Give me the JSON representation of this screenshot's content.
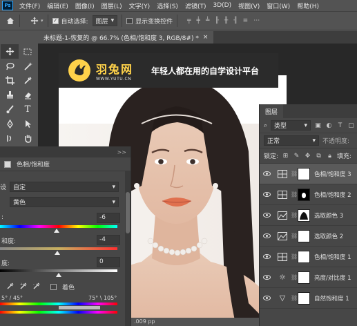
{
  "menubar": {
    "logo": "Ps",
    "items": [
      "文件(F)",
      "编辑(E)",
      "图像(I)",
      "图层(L)",
      "文字(Y)",
      "选择(S)",
      "滤镜(T)",
      "3D(D)",
      "视图(V)",
      "窗口(W)",
      "帮助(H)"
    ]
  },
  "options": {
    "auto_select_label": "自动选择:",
    "auto_select_target": "图层",
    "show_transform_label": "显示变换控件"
  },
  "document": {
    "tab_title": "未标题-1-恢复的 @ 66.7% (色相/饱和度 3, RGB/8#) *",
    "close": "×"
  },
  "watermark": {
    "brand": "羽兔网",
    "url": "WWW.YUTU.CN",
    "slogan": "年轻人都在用的自学设计平台"
  },
  "properties": {
    "panel_expand": ">>",
    "title": "色相/饱和度",
    "preset_label": "设",
    "preset_value": "自定",
    "channel_value": "黄色",
    "hue_label": ":",
    "hue_value": "-6",
    "hue_level": 0.48,
    "saturation_label": "和度:",
    "saturation_value": "-4",
    "saturation_level": 0.49,
    "lightness_label": "度:",
    "lightness_value": "0",
    "lightness_level": 0.5,
    "colorize_label": "着色",
    "range_left": "5° / 45°",
    "range_right": "75° \\ 105°"
  },
  "layers": {
    "tab_label": "图层",
    "filter_kind": "类型",
    "blend_mode": "正常",
    "opacity_label": "不透明度:",
    "lock_label": "锁定:",
    "fill_label": "填充:",
    "items": [
      {
        "name": "色相/饱和度 3",
        "icon": "hue-saturation-icon",
        "mask": "white",
        "selected": true
      },
      {
        "name": "色相/饱和度 2",
        "icon": "hue-saturation-icon",
        "mask": "black-figure",
        "selected": false
      },
      {
        "name": "选取颜色 3",
        "icon": "selective-color-icon",
        "mask": "black-figure-small",
        "selected": false
      },
      {
        "name": "选取颜色 2",
        "icon": "selective-color-icon",
        "mask": "white",
        "selected": false
      },
      {
        "name": "色相/饱和度 1",
        "icon": "hue-saturation-icon",
        "mask": "white",
        "selected": false
      },
      {
        "name": "亮度/对比度 1",
        "icon": "brightness-icon",
        "mask": "white",
        "selected": false
      },
      {
        "name": "自然饱和度 1",
        "icon": "vibrance-icon",
        "mask": "white",
        "selected": false
      }
    ]
  },
  "status": {
    "doc_size": ".009 pp"
  }
}
